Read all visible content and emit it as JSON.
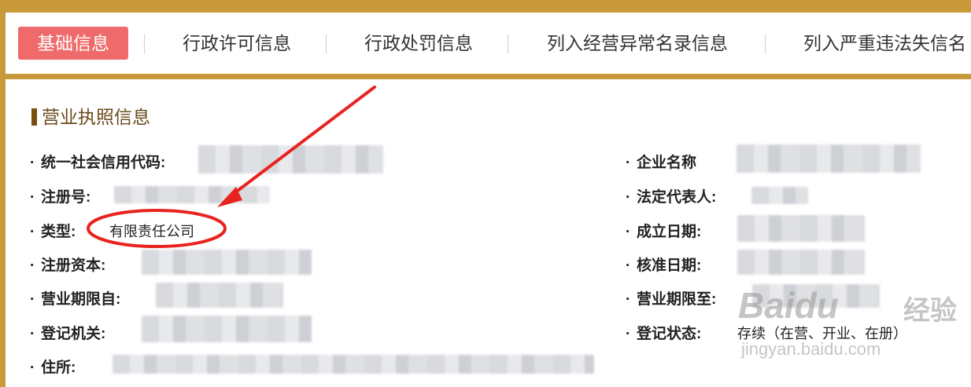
{
  "tabs": [
    {
      "label": "基础信息",
      "active": true
    },
    {
      "label": "行政许可信息",
      "active": false
    },
    {
      "label": "行政处罚信息",
      "active": false
    },
    {
      "label": "列入经营异常名录信息",
      "active": false
    },
    {
      "label": "列入严重违法失信名",
      "active": false
    }
  ],
  "section": {
    "title": "营业执照信息"
  },
  "fields": {
    "credit_code_label": "统一社会信用代码:",
    "company_name_label": "企业名称",
    "reg_no_label": "注册号:",
    "legal_rep_label": "法定代表人:",
    "type_label": "类型:",
    "type_value": "有限责任公司",
    "established_label": "成立日期:",
    "capital_label": "注册资本:",
    "approved_label": "核准日期:",
    "term_from_label": "营业期限自:",
    "term_to_label": "营业期限至:",
    "authority_label": "登记机关:",
    "status_label": "登记状态:",
    "status_value": "存续（在营、开业、在册）",
    "address_label": "住所:"
  },
  "watermark": {
    "brand": "Baidu",
    "sub": "经验",
    "url": "jingyan.baidu.com"
  },
  "colors": {
    "frame": "#c89a3a",
    "active_tab": "#ef6a6a",
    "annotation": "#e8231f",
    "section_title": "#6b4a1e"
  }
}
